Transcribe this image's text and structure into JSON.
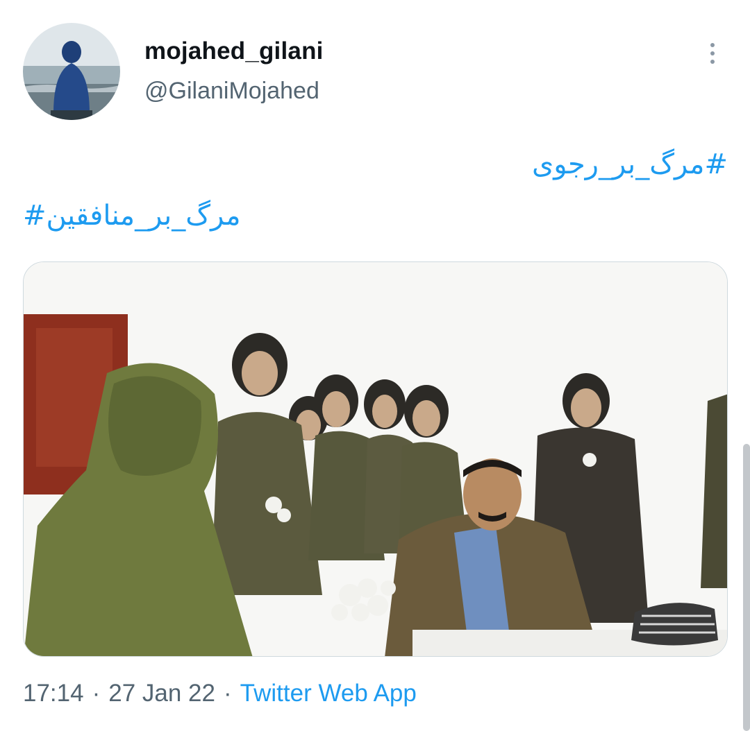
{
  "author": {
    "display_name": "mojahed_gilani",
    "handle": "@GilaniMojahed",
    "avatar_icon": "avatar-photo"
  },
  "tweet": {
    "hashtags": [
      "#مرگ_بر_رجوی",
      "مرگ_بر_منافقین#"
    ],
    "media_icon": "illustration-image"
  },
  "meta": {
    "time": "17:14",
    "separator": "·",
    "date": "27 Jan 22",
    "source": "Twitter Web App"
  },
  "menu": {
    "icon": "more-vertical-icon"
  },
  "colors": {
    "link": "#1d9bf0",
    "secondary_text": "#536471",
    "primary_text": "#0f1419",
    "border": "#cfd9de"
  }
}
